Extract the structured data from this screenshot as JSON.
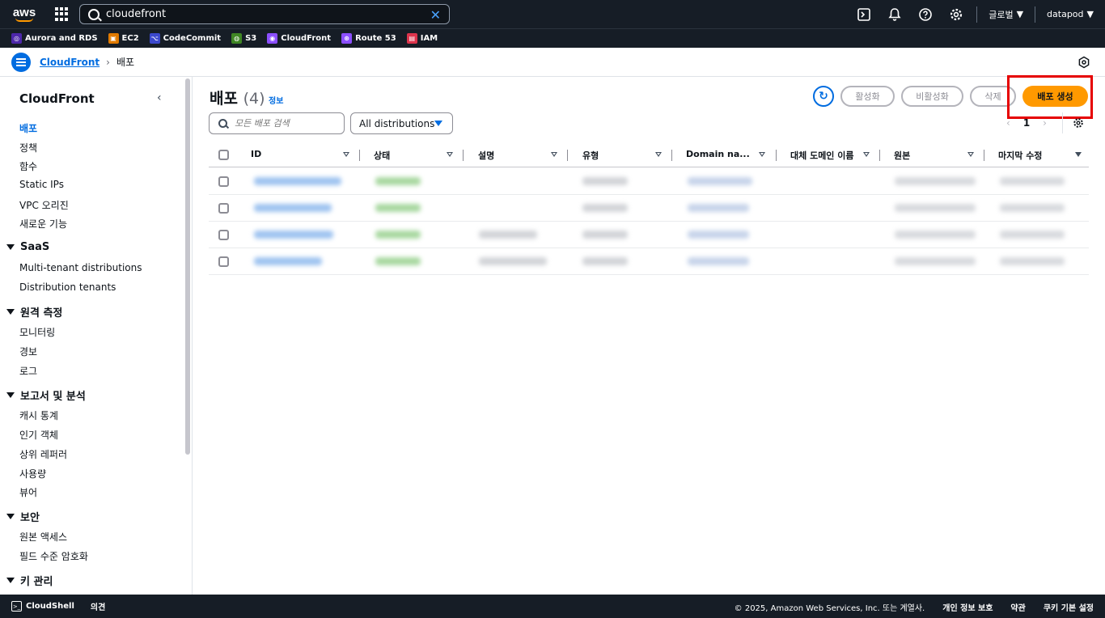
{
  "topnav": {
    "logo_text": "aws",
    "search_value": "cloudefront",
    "region_label": "글로벌",
    "account_label": "datapod"
  },
  "favorites": [
    {
      "label": "Aurora and RDS",
      "color": "#4d27aa",
      "icon": "rds-icon"
    },
    {
      "label": "EC2",
      "color": "#e07a00",
      "icon": "ec2-icon"
    },
    {
      "label": "CodeCommit",
      "color": "#3b48cc",
      "icon": "codecommit-icon"
    },
    {
      "label": "S3",
      "color": "#3f8624",
      "icon": "s3-icon"
    },
    {
      "label": "CloudFront",
      "color": "#8c4fff",
      "icon": "cloudfront-icon"
    },
    {
      "label": "Route 53",
      "color": "#8c4fff",
      "icon": "route53-icon"
    },
    {
      "label": "IAM",
      "color": "#dd344c",
      "icon": "iam-icon"
    }
  ],
  "breadcrumb": {
    "service": "CloudFront",
    "current": "배포"
  },
  "sidebar": {
    "title": "CloudFront",
    "items": [
      "배포",
      "정책",
      "함수",
      "Static IPs",
      "VPC 오리진",
      "새로운 기능"
    ],
    "sections": [
      {
        "title": "SaaS",
        "items": [
          "Multi-tenant distributions",
          "Distribution tenants"
        ]
      },
      {
        "title": "원격 측정",
        "items": [
          "모니터링",
          "경보",
          "로그"
        ]
      },
      {
        "title": "보고서 및 분석",
        "items": [
          "캐시 통계",
          "인기 객체",
          "상위 레퍼러",
          "사용량",
          "뷰어"
        ]
      },
      {
        "title": "보안",
        "items": [
          "원본 액세스",
          "필드 수준 암호화"
        ]
      },
      {
        "title": "키 관리",
        "items": []
      }
    ]
  },
  "main": {
    "title": "배포",
    "count": "(4)",
    "info_label": "정보",
    "buttons": {
      "enable": "활성화",
      "disable": "비활성화",
      "delete": "삭제",
      "create": "배포 생성"
    },
    "search_placeholder": "모든 배포 검색",
    "filter_value": "All distributions",
    "page": "1",
    "columns": [
      "ID",
      "상태",
      "설명",
      "유형",
      "Domain na...",
      "대체 도메인 이름",
      "원본",
      "마지막 수정"
    ]
  },
  "footer": {
    "cloudshell": "CloudShell",
    "feedback": "의견",
    "copyright": "© 2025, Amazon Web Services, Inc. 또는 계열사.",
    "privacy": "개인 정보 보호",
    "terms": "약관",
    "cookies": "쿠키 기본 설정"
  }
}
